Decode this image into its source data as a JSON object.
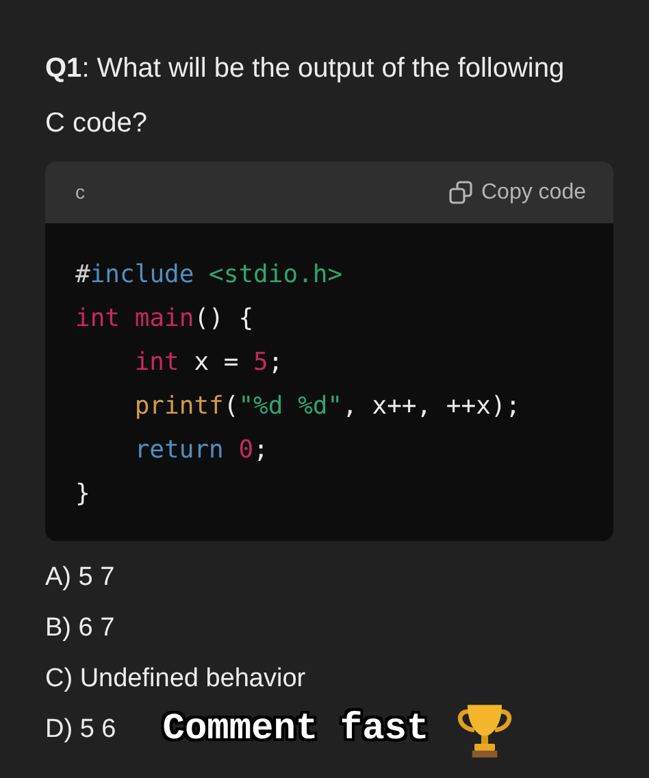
{
  "question": {
    "text": "**Q1**: What will be the output of the following C code?"
  },
  "code_block": {
    "language": "c",
    "copy_label": "Copy code",
    "lines": [
      [
        {
          "kind": "preproc",
          "text": "#"
        },
        {
          "kind": "keyword2",
          "text": "include "
        },
        {
          "kind": "string",
          "text": "<stdio.h>"
        }
      ],
      [
        {
          "kind": "keyword",
          "text": "int "
        },
        {
          "kind": "keyword",
          "text": "main"
        },
        {
          "kind": "plain",
          "text": "() {"
        }
      ],
      [
        {
          "kind": "keyword",
          "text": "    int"
        },
        {
          "kind": "plain",
          "text": " x = "
        },
        {
          "kind": "number",
          "text": "5"
        },
        {
          "kind": "plain",
          "text": ";"
        }
      ],
      [
        {
          "kind": "function",
          "text": "    printf"
        },
        {
          "kind": "plain",
          "text": "("
        },
        {
          "kind": "string",
          "text": "\"%d %d\""
        },
        {
          "kind": "plain",
          "text": ", x++, ++x);"
        }
      ],
      [
        {
          "kind": "keyword2",
          "text": "    return "
        },
        {
          "kind": "number",
          "text": "0"
        },
        {
          "kind": "plain",
          "text": ";"
        }
      ],
      [
        {
          "kind": "plain",
          "text": "}"
        }
      ]
    ]
  },
  "options": [
    "A) 5 7",
    "B) 6 7",
    "C) Undefined behavior",
    "D) 5 6"
  ],
  "caption": {
    "text": "Comment fast"
  }
}
